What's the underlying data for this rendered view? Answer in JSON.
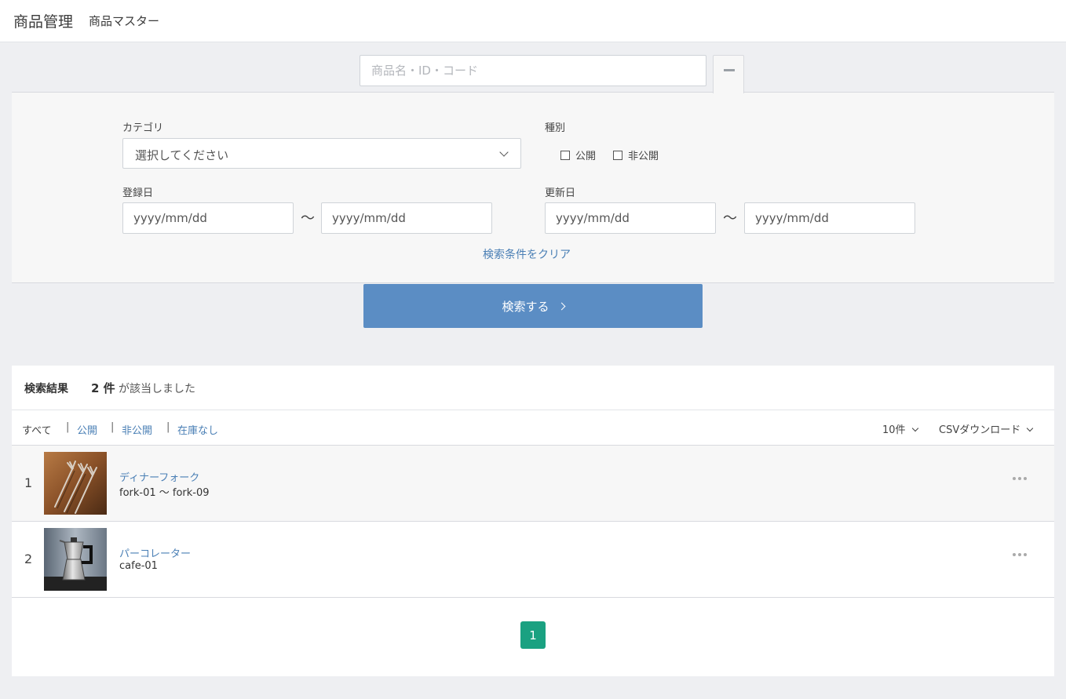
{
  "header": {
    "title": "商品管理",
    "subtitle": "商品マスター"
  },
  "search": {
    "placeholder": "商品名・ID・コード",
    "value": ""
  },
  "filters": {
    "category_label": "カテゴリ",
    "category_value": "選択してください",
    "type_label": "種別",
    "type_options": [
      {
        "label": "公開",
        "checked": false
      },
      {
        "label": "非公開",
        "checked": false
      }
    ],
    "registered_label": "登録日",
    "updated_label": "更新日",
    "date_placeholder": "yyyy/mm/dd",
    "range_separator": "〜",
    "clear_label": "検索条件をクリア"
  },
  "search_button": "検索する",
  "results": {
    "title": "検索結果",
    "count_text": "2 件",
    "tail_text": "が該当しました",
    "tabs": [
      {
        "label": "すべて",
        "active": true
      },
      {
        "label": "公開",
        "active": false
      },
      {
        "label": "非公開",
        "active": false
      },
      {
        "label": "在庫なし",
        "active": false
      }
    ],
    "tab_separator": "|",
    "per_page": "10件",
    "csv_label": "CSVダウンロード",
    "items": [
      {
        "index": "1",
        "name": "ディナーフォーク",
        "code": "fork-01 〜 fork-09",
        "image": "forks-photo"
      },
      {
        "index": "2",
        "name": "パーコレーター",
        "code": "cafe-01",
        "image": "percolator-photo"
      }
    ],
    "pagination": {
      "current": "1"
    }
  },
  "colors": {
    "accent": "#5b8dc4",
    "link": "#4a7fb5",
    "page_active": "#1aa181",
    "background": "#eeeff2"
  }
}
